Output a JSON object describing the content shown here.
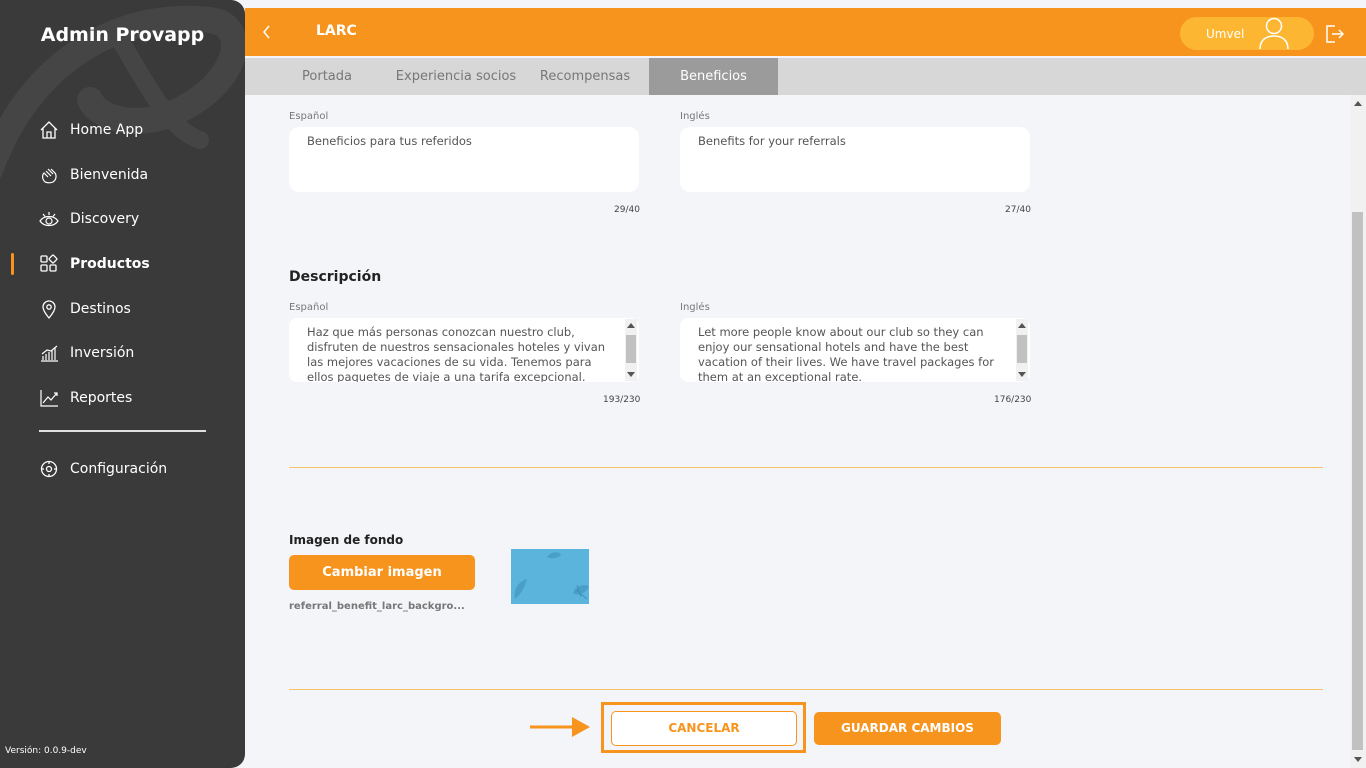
{
  "sidebar": {
    "title": "Admin Provapp",
    "items": [
      {
        "label": "Home App",
        "icon": "home-icon"
      },
      {
        "label": "Bienvenida",
        "icon": "wave-hand-icon"
      },
      {
        "label": "Discovery",
        "icon": "eye-icon"
      },
      {
        "label": "Productos",
        "icon": "grid-icon",
        "active": true
      },
      {
        "label": "Destinos",
        "icon": "location-pin-icon"
      },
      {
        "label": "Inversión",
        "icon": "bar-chart-icon"
      },
      {
        "label": "Reportes",
        "icon": "line-chart-icon"
      }
    ],
    "config_label": "Configuración",
    "version": "Versión: 0.0.9-dev"
  },
  "header": {
    "brand": "LARC",
    "user_name": "Umvel"
  },
  "tabs": [
    {
      "label": "Portada"
    },
    {
      "label": "Experiencia socios"
    },
    {
      "label": "Recompensas"
    },
    {
      "label": "Beneficios",
      "active": true
    }
  ],
  "title_section": {
    "es_label": "Español",
    "en_label": "Inglés",
    "es_value": "Beneficios para tus referidos",
    "en_value": "Benefits for your referrals",
    "es_count": "29/40",
    "en_count": "27/40"
  },
  "description_section": {
    "heading": "Descripción",
    "es_label": "Español",
    "en_label": "Inglés",
    "es_value": "Haz que más personas conozcan nuestro club, disfruten de nuestros sensacionales hoteles y vivan las mejores vacaciones de su vida. Tenemos para ellos paquetes de viaje a una tarifa excepcional.",
    "en_value": "Let more people know about our club so they can enjoy our sensational hotels and have the best vacation of their lives. We have travel packages for them at an exceptional rate.",
    "es_count": "193/230",
    "en_count": "176/230"
  },
  "background_image": {
    "label": "Imagen de fondo",
    "change_button": "Cambiar imagen",
    "filename": "referral_benefit_larc_backgro..."
  },
  "actions": {
    "cancel": "CANCELAR",
    "save": "GUARDAR CAMBIOS"
  },
  "colors": {
    "accent": "#f7941d",
    "sidebar": "#3a3a3a",
    "accent_light": "#fcb632"
  }
}
